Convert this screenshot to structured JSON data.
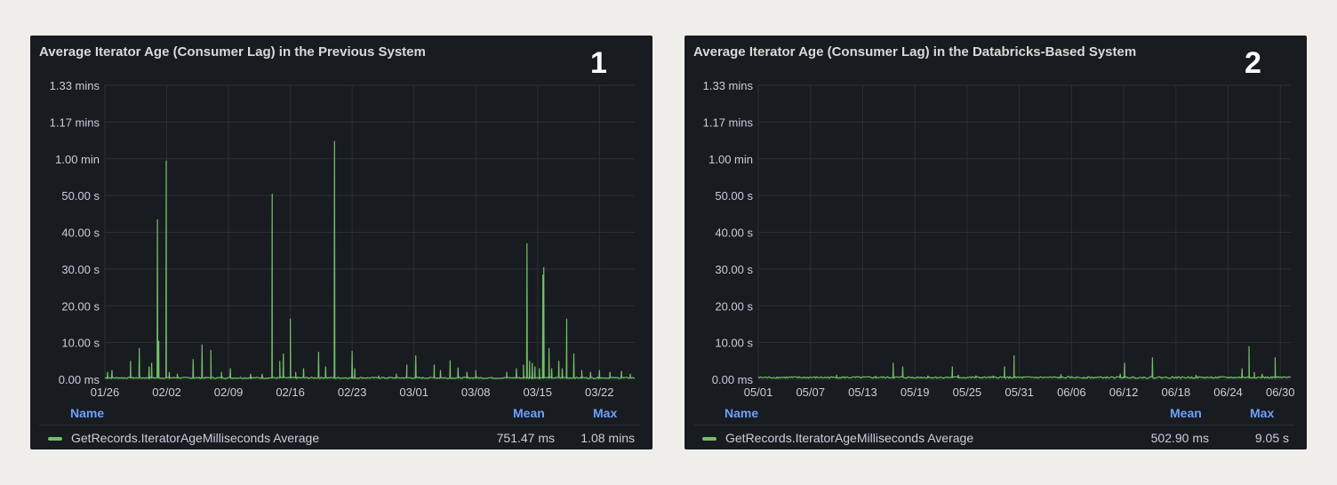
{
  "colors": {
    "line": "#73bf69",
    "grid": "#2c2f34",
    "tick": "#ccccdc",
    "legend_header": "#6e9fff"
  },
  "chart_data": [
    {
      "type": "line",
      "title": "Average Iterator Age (Consumer Lag) in the Previous System",
      "panel_number": "1",
      "ylabel": "",
      "xlabel": "",
      "ylim": [
        0,
        80
      ],
      "y_unit": "seconds",
      "y_ticks": [
        {
          "v": 0,
          "label": "0.00 ms"
        },
        {
          "v": 10,
          "label": "10.00 s"
        },
        {
          "v": 20,
          "label": "20.00 s"
        },
        {
          "v": 30,
          "label": "30.00 s"
        },
        {
          "v": 40,
          "label": "40.00 s"
        },
        {
          "v": 50,
          "label": "50.00 s"
        },
        {
          "v": 60,
          "label": "1.00 min"
        },
        {
          "v": 70,
          "label": "1.17 mins"
        },
        {
          "v": 80,
          "label": "1.33 mins"
        }
      ],
      "x_unit": "days since 01/26",
      "xlim": [
        0,
        60
      ],
      "x_ticks": [
        {
          "v": 0,
          "label": "01/26"
        },
        {
          "v": 7,
          "label": "02/02"
        },
        {
          "v": 14,
          "label": "02/09"
        },
        {
          "v": 21,
          "label": "02/16"
        },
        {
          "v": 28,
          "label": "02/23"
        },
        {
          "v": 35,
          "label": "03/01"
        },
        {
          "v": 42,
          "label": "03/08"
        },
        {
          "v": 49,
          "label": "03/15"
        },
        {
          "v": 56,
          "label": "03/22"
        }
      ],
      "grid": true,
      "baseline_s": 0.4,
      "spikes": [
        [
          0.3,
          2
        ],
        [
          0.8,
          2.5
        ],
        [
          2.9,
          5
        ],
        [
          3.9,
          8.5
        ],
        [
          5.0,
          3.5
        ],
        [
          5.3,
          4.5
        ],
        [
          5.95,
          43.5
        ],
        [
          6.1,
          10.5
        ],
        [
          6.95,
          59.5
        ],
        [
          7.3,
          2
        ],
        [
          8.2,
          1.5
        ],
        [
          10,
          5.5
        ],
        [
          11,
          9.5
        ],
        [
          12,
          8
        ],
        [
          13.2,
          2
        ],
        [
          14.2,
          3
        ],
        [
          16.5,
          1.5
        ],
        [
          17.8,
          1.5
        ],
        [
          18.95,
          50.5
        ],
        [
          19.8,
          5
        ],
        [
          20.2,
          7
        ],
        [
          21,
          16.5
        ],
        [
          21.6,
          2
        ],
        [
          22.5,
          3
        ],
        [
          24.2,
          7.5
        ],
        [
          25,
          3.5
        ],
        [
          26,
          64.8
        ],
        [
          28,
          7.7
        ],
        [
          28.3,
          3
        ],
        [
          31,
          1
        ],
        [
          33,
          1.5
        ],
        [
          34.2,
          4
        ],
        [
          35.2,
          6.5
        ],
        [
          37.3,
          4
        ],
        [
          38,
          2.5
        ],
        [
          39.1,
          5.2
        ],
        [
          40,
          3.2
        ],
        [
          41,
          2
        ],
        [
          42,
          2.5
        ],
        [
          45.5,
          2
        ],
        [
          46.6,
          3
        ],
        [
          47.4,
          4
        ],
        [
          47.8,
          37
        ],
        [
          48.1,
          5
        ],
        [
          48.4,
          4.5
        ],
        [
          48.7,
          3.5
        ],
        [
          49.2,
          3
        ],
        [
          49.6,
          28.5
        ],
        [
          49.7,
          30.5
        ],
        [
          50.3,
          8.5
        ],
        [
          50.6,
          3
        ],
        [
          51.4,
          5
        ],
        [
          51.8,
          3
        ],
        [
          52.3,
          16.5
        ],
        [
          53.1,
          7
        ],
        [
          54,
          2.5
        ],
        [
          55,
          2
        ],
        [
          56,
          2.5
        ],
        [
          57.2,
          2
        ],
        [
          58.5,
          2.3
        ],
        [
          59.5,
          1.5
        ]
      ],
      "legend": {
        "headers": {
          "name": "Name",
          "mean": "Mean",
          "max": "Max"
        },
        "series": [
          {
            "name": "GetRecords.IteratorAgeMilliseconds Average",
            "mean": "751.47 ms",
            "max": "1.08 mins"
          }
        ]
      }
    },
    {
      "type": "line",
      "title": "Average Iterator Age (Consumer Lag) in the Databricks-Based System",
      "panel_number": "2",
      "ylabel": "",
      "xlabel": "",
      "ylim": [
        0,
        80
      ],
      "y_unit": "seconds",
      "y_ticks": [
        {
          "v": 0,
          "label": "0.00 ms"
        },
        {
          "v": 10,
          "label": "10.00 s"
        },
        {
          "v": 20,
          "label": "20.00 s"
        },
        {
          "v": 30,
          "label": "30.00 s"
        },
        {
          "v": 40,
          "label": "40.00 s"
        },
        {
          "v": 50,
          "label": "50.00 s"
        },
        {
          "v": 60,
          "label": "1.00 min"
        },
        {
          "v": 70,
          "label": "1.17 mins"
        },
        {
          "v": 80,
          "label": "1.33 mins"
        }
      ],
      "x_unit": "days since 05/01",
      "xlim": [
        0,
        61.2
      ],
      "x_ticks": [
        {
          "v": 0,
          "label": "05/01"
        },
        {
          "v": 6,
          "label": "05/07"
        },
        {
          "v": 12,
          "label": "05/13"
        },
        {
          "v": 18,
          "label": "05/19"
        },
        {
          "v": 24,
          "label": "05/25"
        },
        {
          "v": 30,
          "label": "05/31"
        },
        {
          "v": 36,
          "label": "06/06"
        },
        {
          "v": 42,
          "label": "06/12"
        },
        {
          "v": 48,
          "label": "06/18"
        },
        {
          "v": 54,
          "label": "06/24"
        },
        {
          "v": 60,
          "label": "06/30"
        }
      ],
      "grid": true,
      "baseline_s": 0.5,
      "spikes": [
        [
          9,
          1.2
        ],
        [
          13.5,
          0.9
        ],
        [
          15.5,
          4.5
        ],
        [
          16.6,
          3.5
        ],
        [
          19.5,
          1
        ],
        [
          22.3,
          3.5
        ],
        [
          23,
          1.2
        ],
        [
          25,
          1
        ],
        [
          27,
          1
        ],
        [
          28.3,
          3.5
        ],
        [
          29.4,
          6.5
        ],
        [
          34.8,
          1.4
        ],
        [
          41.6,
          1.5
        ],
        [
          42.1,
          4.5
        ],
        [
          45.3,
          6
        ],
        [
          50.3,
          1.2
        ],
        [
          55.6,
          3
        ],
        [
          56.4,
          9
        ],
        [
          57,
          2
        ],
        [
          57.9,
          1.5
        ],
        [
          59.4,
          6
        ]
      ],
      "legend": {
        "headers": {
          "name": "Name",
          "mean": "Mean",
          "max": "Max"
        },
        "series": [
          {
            "name": "GetRecords.IteratorAgeMilliseconds Average",
            "mean": "502.90 ms",
            "max": "9.05 s"
          }
        ]
      }
    }
  ]
}
